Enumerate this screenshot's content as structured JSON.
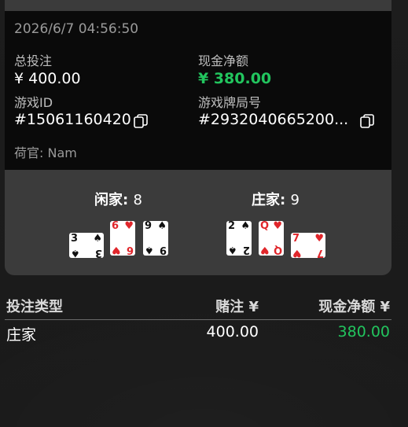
{
  "round": {
    "timestamp": "2026/6/7 04:56:50",
    "total_bet_label": "总投注",
    "total_bet_value": "¥ 400.00",
    "net_cash_label": "现金净额",
    "net_cash_value": "¥ 380.00",
    "game_id_label": "游戏ID",
    "game_id_value": "#15061160420",
    "round_no_label": "游戏牌局号",
    "round_no_value": "#2932040665200...",
    "dealer_text": "荷官: Nam"
  },
  "hands": {
    "player_label": "闲家:",
    "player_score": "8",
    "banker_label": "庄家:",
    "banker_score": "9",
    "player_cards": [
      {
        "rank": "3",
        "suit": "♠",
        "color": "black",
        "rotated": true
      },
      {
        "rank": "6",
        "suit": "♥",
        "color": "red",
        "rotated": false
      },
      {
        "rank": "9",
        "suit": "♠",
        "color": "black",
        "rotated": false
      }
    ],
    "banker_cards": [
      {
        "rank": "2",
        "suit": "♠",
        "color": "black",
        "rotated": false
      },
      {
        "rank": "Q",
        "suit": "♥",
        "color": "red",
        "rotated": false
      },
      {
        "rank": "7",
        "suit": "♥",
        "color": "red",
        "rotated": true
      }
    ]
  },
  "bets_table": {
    "headers": [
      "投注类型",
      "赌注 ¥",
      "现金净额 ¥"
    ],
    "rows": [
      {
        "type": "庄家",
        "stake": "400.00",
        "net": "380.00"
      }
    ]
  },
  "colors": {
    "accent_green": "#22c55e",
    "card_red": "#e0262b"
  },
  "icons": {
    "copy": "copy-icon"
  }
}
